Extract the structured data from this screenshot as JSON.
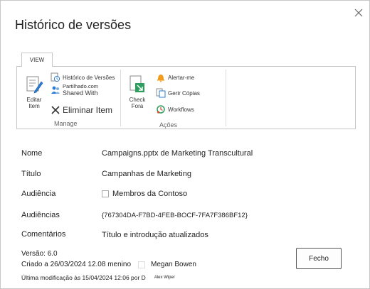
{
  "dialog": {
    "title": "Histórico de versões",
    "close_label": "×"
  },
  "ribbon": {
    "tab_label": "VIEW",
    "manage": {
      "edit_item": [
        "Editar",
        "Item"
      ],
      "version_history": "Histórico de Versões",
      "shared_with_top": "Partilhado.com",
      "shared_with": "Shared With",
      "delete_item": "Eliminar Item",
      "group_label": "Manage"
    },
    "actions": {
      "check_out": [
        "Check",
        "Fora"
      ],
      "alert_me": "Alertar-me",
      "manage_copies": "Gerir Cópias",
      "workflows": "Workflows",
      "group_label": "Ações"
    }
  },
  "properties": [
    {
      "label": "Nome",
      "value": "Campaigns.pptx de Marketing Transcultural"
    },
    {
      "label": "Título",
      "value": "Campanhas de Marketing"
    },
    {
      "label": "Audiência",
      "value": "Membros da Contoso"
    },
    {
      "label": "Audiências",
      "value": "{767304DA-F7BD-4FEB-BOCF-7FA7F386BF12}"
    },
    {
      "label": "Comentários",
      "value": "Título e introdução atualizados"
    }
  ],
  "footer": {
    "version": "Versão: 6.0",
    "created": "Criado a 26/03/2024 12.08 menino",
    "created_by": "Megan Bowen",
    "modified": "Última modificação às 15/04/2024 12:06 por D",
    "modified_by": "Alex Wiper"
  },
  "close_button_label": "Fecho",
  "colors": {
    "accent_blue": "#2b7cd3",
    "alert_orange": "#f29b1d",
    "check_green": "#2e9e5e",
    "delete_dark": "#333333"
  }
}
